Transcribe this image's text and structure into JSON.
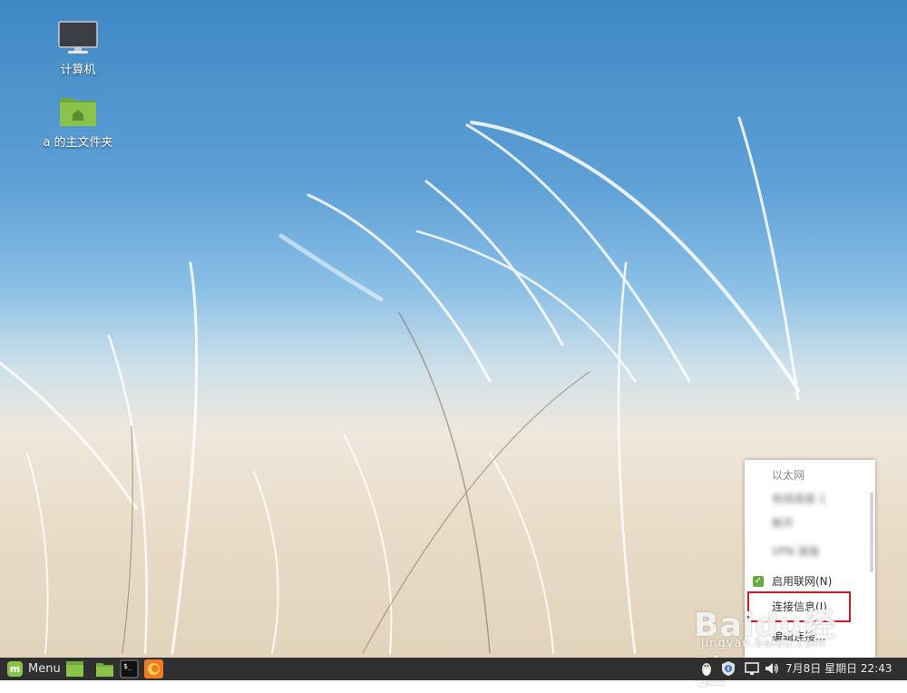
{
  "desktop": {
    "icons": [
      {
        "label": "计算机",
        "icon": "monitor-icon"
      },
      {
        "label": "a 的主文件夹",
        "icon": "home-folder-icon"
      }
    ]
  },
  "network_menu": {
    "section_title": "以太网",
    "blurred_items": [
      "有线连接 1",
      "断开",
      "VPN 连接"
    ],
    "enable_networking": {
      "label": "启用联网(N)",
      "checked": true
    },
    "connection_info": {
      "label": "连接信息(I)"
    },
    "edit_connections": {
      "label": "编辑连接..."
    }
  },
  "watermark": {
    "logo": "Baidu经验",
    "url": "jingyan.baidu.com"
  },
  "taskbar": {
    "menu_label": "Menu",
    "launchers": [
      "show-desktop-icon",
      "file-manager-icon",
      "terminal-icon",
      "firefox-icon"
    ],
    "tray_icons": [
      "linux-penguin-icon",
      "shield-update-icon",
      "network-icon",
      "volume-icon"
    ],
    "clock": "7月8日 星期日 22:43"
  },
  "colors": {
    "taskbar_bg": "#2f2f2f",
    "mint_green": "#8ac24a",
    "highlight_red": "#d4182a",
    "sky_blue": "#3f88c4"
  }
}
